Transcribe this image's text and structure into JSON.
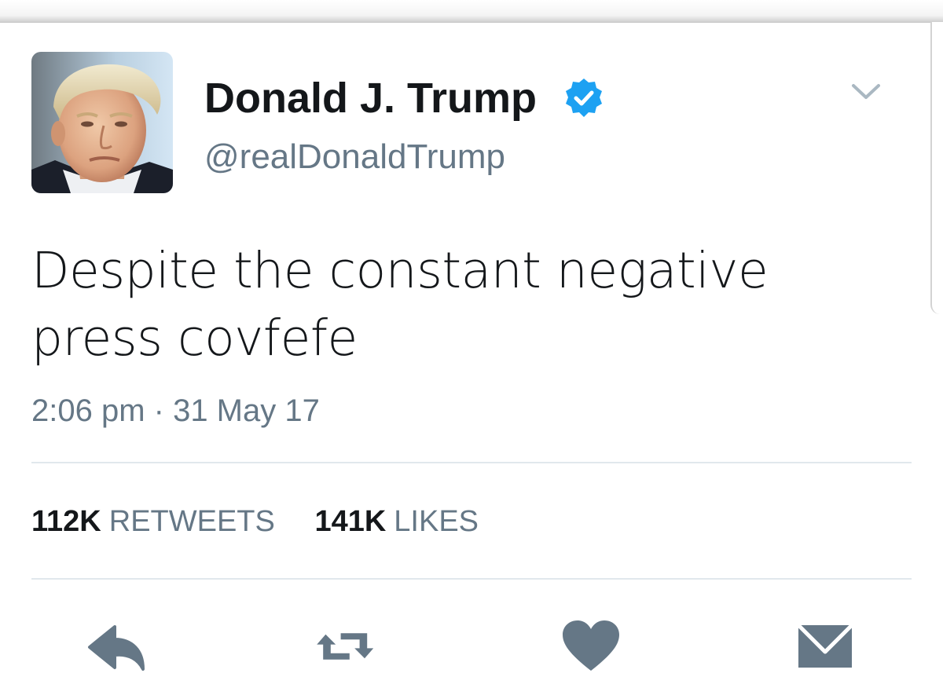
{
  "tweet": {
    "display_name": "Donald J. Trump",
    "handle": "@realDonaldTrump",
    "verified": true,
    "text": "Despite the constant negative press covfefe",
    "timestamp": "2:06 pm · 31 May 17"
  },
  "stats": {
    "retweets_count": "112K",
    "retweets_label": "RETWEETS",
    "likes_count": "141K",
    "likes_label": "LIKES"
  },
  "icons": {
    "verified": "verified-badge-icon",
    "caret": "chevron-down-icon",
    "reply": "reply-icon",
    "retweet": "retweet-icon",
    "like": "heart-icon",
    "dm": "envelope-icon"
  },
  "colors": {
    "verified_blue": "#1da1f2",
    "secondary_text": "#657786",
    "icon_gray": "#657786",
    "divider": "#e1e8ed"
  }
}
